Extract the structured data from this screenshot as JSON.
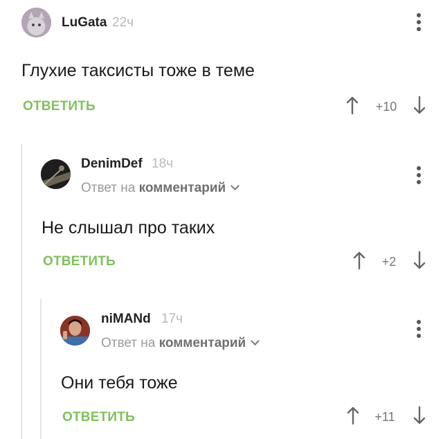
{
  "comments": [
    {
      "username": "LuGata",
      "time": "22ч",
      "text": "Глухие таксисты тоже в теме",
      "reply_label": "ОТВЕТИТЬ",
      "rating": "+10"
    },
    {
      "username": "DenimDef",
      "time": "18ч",
      "reply_to_prefix": "Ответ на",
      "reply_to_link": "комментарий",
      "text": "Не слышал про таких",
      "reply_label": "ОТВЕТИТЬ",
      "rating": "+2"
    },
    {
      "username": "niMANd",
      "time": "17ч",
      "reply_to_prefix": "Ответ на",
      "reply_to_link": "комментарий",
      "text": "Они тебя тоже",
      "reply_label": "ОТВЕТИТЬ",
      "rating": "+11"
    }
  ],
  "colors": {
    "accent_green": "#7ec25a",
    "thread_line": "#e4e4e4",
    "muted_text": "#9a9a9a"
  },
  "icons": {
    "menu": "more-vertical-icon",
    "upvote": "arrow-up-icon",
    "downvote": "arrow-down-icon",
    "reply_expand": "chevron-down-icon"
  }
}
